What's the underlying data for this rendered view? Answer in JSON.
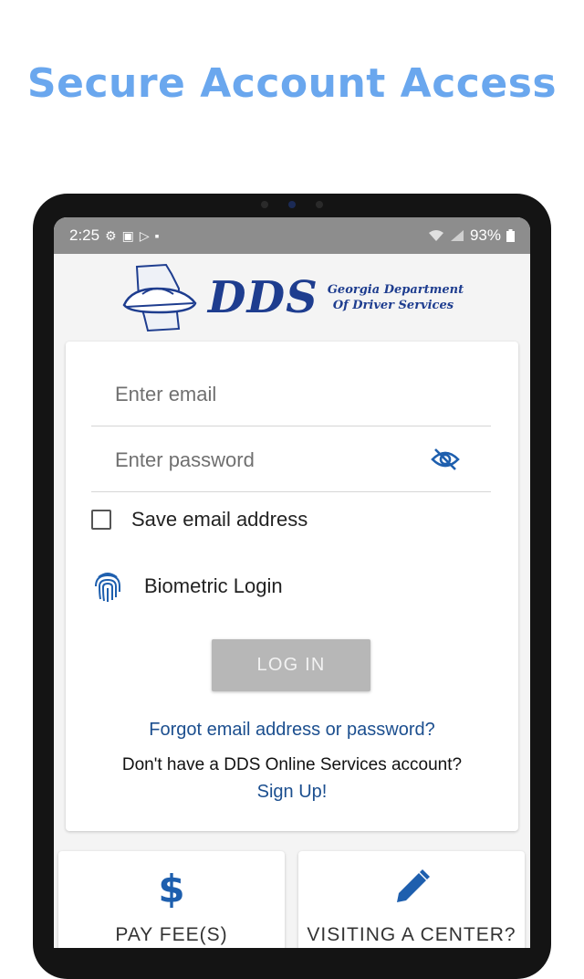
{
  "headline": "Secure Account Access",
  "status_bar": {
    "time": "2:25",
    "battery": "93%"
  },
  "logo": {
    "wordmark": "DDS",
    "dept_line1": "Georgia Department",
    "dept_line2": "Of Driver Services"
  },
  "login_form": {
    "email_placeholder": "Enter email",
    "email_value": "",
    "password_placeholder": "Enter password",
    "password_value": "",
    "save_email_label": "Save email address",
    "save_email_checked": false,
    "biometric_label": "Biometric Login",
    "login_button": "LOG IN",
    "forgot_link": "Forgot email address or password?",
    "no_account_text": "Don't have a DDS Online Services account?",
    "signup_link": "Sign Up!"
  },
  "tiles": [
    {
      "label": "PAY FEE(S)",
      "icon": "dollar-icon"
    },
    {
      "label": "VISITING A CENTER?",
      "icon": "pencil-icon"
    }
  ],
  "colors": {
    "headline": "#6aa7ee",
    "brand_blue": "#1e3d8f",
    "link": "#1c4f8f",
    "button_disabled": "#b7b7b7"
  }
}
